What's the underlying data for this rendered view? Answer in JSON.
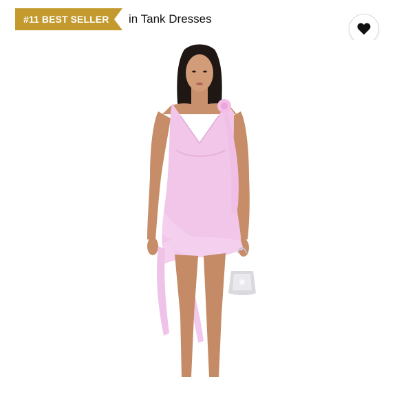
{
  "badge": {
    "text": "#11 BEST SELLER",
    "color": "#c49a2f",
    "text_color": "#ffffff"
  },
  "category": {
    "text": "in Tank Dresses"
  },
  "favorite": {
    "icon": "heart-icon",
    "icon_color": "#111111"
  },
  "product": {
    "image_subject": "model wearing pink ruffled mini tank dress holding silver bag",
    "dress_color": "#f1c6e9"
  }
}
